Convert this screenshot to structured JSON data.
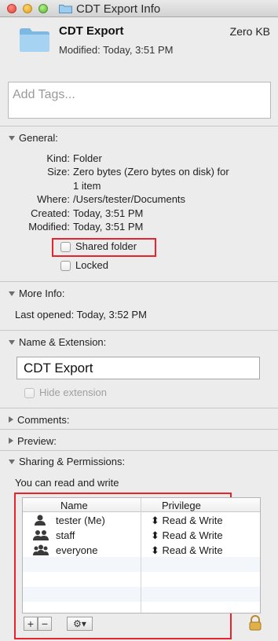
{
  "window": {
    "title": "CDT Export Info"
  },
  "header": {
    "name": "CDT Export",
    "size": "Zero KB",
    "modified": "Modified: Today, 3:51 PM"
  },
  "tags": {
    "placeholder": "Add Tags..."
  },
  "sections": {
    "general": "General:",
    "more_info": "More Info:",
    "name_extension": "Name & Extension:",
    "comments": "Comments:",
    "preview": "Preview:",
    "sharing": "Sharing & Permissions:"
  },
  "general": {
    "kind_label": "Kind:",
    "kind": "Folder",
    "size_label": "Size:",
    "size_line1": "Zero bytes (Zero bytes on disk) for",
    "size_line2": "1 item",
    "where_label": "Where:",
    "where": "/Users/tester/Documents",
    "created_label": "Created:",
    "created": "Today, 3:51 PM",
    "modified_label": "Modified:",
    "modified": "Today, 3:51 PM",
    "shared_folder_label": "Shared folder",
    "locked_label": "Locked"
  },
  "more_info": {
    "last_opened": "Last opened: Today, 3:52 PM"
  },
  "name_extension": {
    "name_value": "CDT Export",
    "hide_extension_label": "Hide extension"
  },
  "sharing": {
    "summary": "You can read and write",
    "columns": {
      "name": "Name",
      "privilege": "Privilege"
    },
    "rows": [
      {
        "name": "tester (Me)",
        "privilege": "Read & Write",
        "icon": "single-user-icon"
      },
      {
        "name": "staff",
        "privilege": "Read & Write",
        "icon": "group-icon"
      },
      {
        "name": "everyone",
        "privilege": "Read & Write",
        "icon": "everyone-icon"
      }
    ],
    "add_label": "+",
    "remove_label": "−",
    "action_label": "⚙▾"
  },
  "colors": {
    "highlight": "#e8232d",
    "folder": "#8ec3ea"
  }
}
